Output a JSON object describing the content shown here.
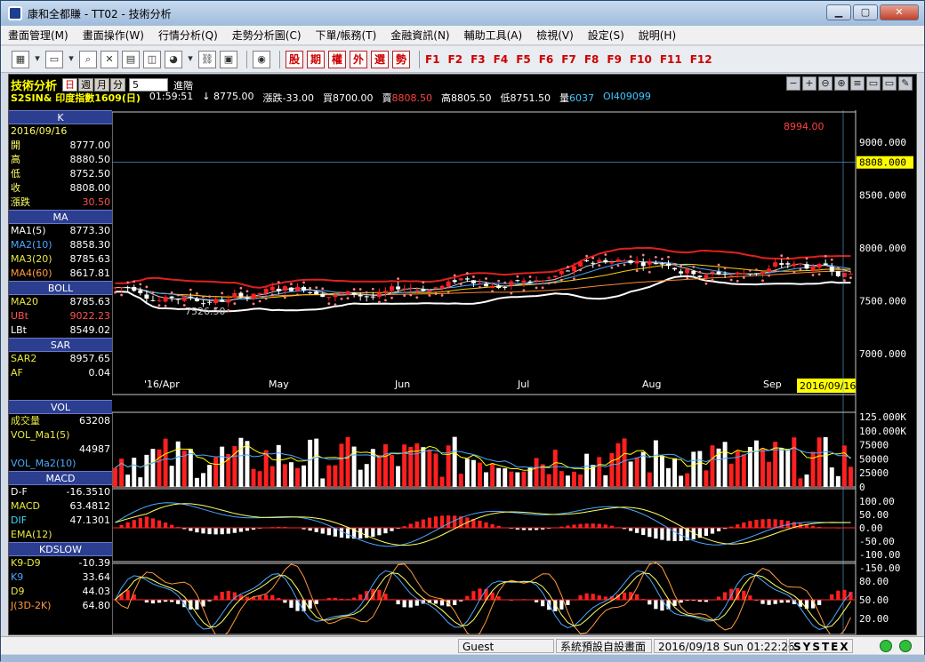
{
  "window": {
    "title": "康和全都賺 - TT02 - 技術分析",
    "minimize": "▁",
    "maximize": "▢",
    "close": "✕"
  },
  "menu": [
    "畫面管理(M)",
    "畫面操作(W)",
    "行情分析(Q)",
    "走勢分析圖(C)",
    "下單/帳務(T)",
    "金融資訊(N)",
    "輔助工具(A)",
    "檢視(V)",
    "設定(S)",
    "說明(H)"
  ],
  "toolbar": {
    "redbuttons": [
      "股",
      "期",
      "權",
      "外",
      "選",
      "勢"
    ],
    "fkeys": [
      "F1",
      "F2",
      "F3",
      "F4",
      "F5",
      "F6",
      "F7",
      "F8",
      "F9",
      "F10",
      "F11",
      "F12"
    ]
  },
  "info": {
    "title": "技術分析",
    "periods": [
      "日",
      "週",
      "月",
      "分"
    ],
    "period_value": "5",
    "advanced": "進階",
    "symbol": "S2SIN& 印度指數1609(日)",
    "time": "01:59:51",
    "last": "↓ 8775.00",
    "change": "漲跌-33.00",
    "bid": "買8700.00",
    "ask_label": "賣",
    "ask": "8808.50",
    "high": "高8805.50",
    "low": "低8751.50",
    "vol_label": "量",
    "vol": "6037",
    "oi": "OI409099",
    "rbtns": [
      "−",
      "+",
      "⊖",
      "⊕",
      "≡",
      "▭",
      "▭",
      "✎"
    ]
  },
  "left": {
    "k": {
      "head": "K",
      "date": "2016/09/16",
      "rows": [
        [
          "開",
          "8777.00"
        ],
        [
          "高",
          "8880.50"
        ],
        [
          "低",
          "8752.50"
        ],
        [
          "收",
          "8808.00"
        ],
        [
          "漲跌",
          "30.50"
        ]
      ]
    },
    "ma": {
      "head": "MA",
      "rows": [
        [
          "MA1(5)",
          "8773.30"
        ],
        [
          "MA2(10)",
          "8858.30"
        ],
        [
          "MA3(20)",
          "8785.63"
        ],
        [
          "MA4(60)",
          "8617.81"
        ]
      ]
    },
    "boll": {
      "head": "BOLL",
      "rows": [
        [
          "MA20",
          "8785.63"
        ],
        [
          "UBt",
          "9022.23"
        ],
        [
          "LBt",
          "8549.02"
        ]
      ]
    },
    "sar": {
      "head": "SAR",
      "rows": [
        [
          "SAR2",
          "8957.65"
        ],
        [
          "AF",
          "0.04"
        ]
      ]
    },
    "vol": {
      "head": "VOL",
      "rows": [
        [
          "成交量",
          "63208"
        ],
        [
          "VOL_Ma1(5)",
          ""
        ],
        [
          "",
          "44987"
        ],
        [
          "VOL_Ma2(10)",
          ""
        ]
      ]
    },
    "macd": {
      "head": "MACD",
      "rows": [
        [
          "D-F",
          "-16.3510"
        ],
        [
          "MACD",
          "63.4812"
        ],
        [
          "DIF",
          "47.1301"
        ],
        [
          "EMA(12)",
          ""
        ]
      ]
    },
    "kd": {
      "head": "KDSLOW",
      "rows": [
        [
          "K9-D9",
          "-10.39"
        ],
        [
          "K9",
          "33.64"
        ],
        [
          "D9",
          "44.03"
        ],
        [
          "J(3D-2K)",
          "64.80"
        ]
      ]
    }
  },
  "chart": {
    "price_ticks": [
      "9000.000",
      "8500.000",
      "8000.000",
      "7500.000",
      "7000.000"
    ],
    "price_tick_values": [
      9000,
      8500,
      8000,
      7500,
      7000
    ],
    "current_price": "8808.000",
    "current_price_value": 8808,
    "max_label": "8994.00",
    "min_label": "7526.50",
    "months": [
      "'16/Apr",
      "May",
      "Jun",
      "Jul",
      "Aug",
      "Sep"
    ],
    "cursor_date": "2016/09/16",
    "vol_ticks": [
      "125.000K",
      "100.000K",
      "75000",
      "50000",
      "25000",
      "0"
    ],
    "macd_ticks": [
      "100.00",
      "50.00",
      "0.00",
      "-50.00",
      "-100.00",
      "-150.00"
    ],
    "kd_ticks": [
      "80.00",
      "50.00",
      "20.00"
    ]
  },
  "status": {
    "user": "Guest",
    "screen": "系統預設自設畫面",
    "datetime": "2016/09/18 Sun 01:22:26",
    "brand": "SYSTEX"
  },
  "colors": {
    "up": "#ff2020",
    "down": "#ffffff",
    "sar": "#ff8080",
    "ma20": "#ffd000",
    "ma60": "#ff8a30",
    "boll_up": "#e02020",
    "boll_dn": "#ffffff"
  }
}
